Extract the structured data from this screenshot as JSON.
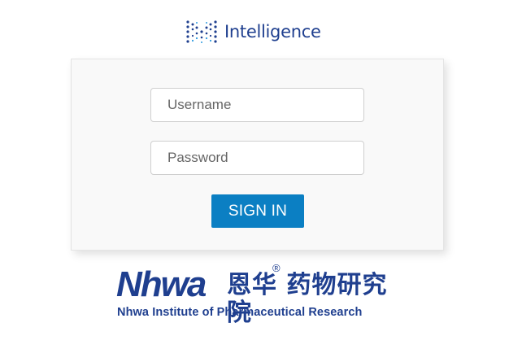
{
  "header": {
    "logo_icon": "dotted-m-icon",
    "logo_text": "Intelligence"
  },
  "login": {
    "username_placeholder": "Username",
    "password_placeholder": "Password",
    "signin_label": "SIGN IN"
  },
  "brand": {
    "mark": "Nhwa",
    "registered": "®",
    "name_cn": "恩华 药物研究院",
    "name_en": "Nhwa Institute of Pharmaceutical Research"
  },
  "colors": {
    "brand_blue": "#1f3f8f",
    "button_blue": "#0b7fc3",
    "card_bg": "#f9f9f9"
  }
}
